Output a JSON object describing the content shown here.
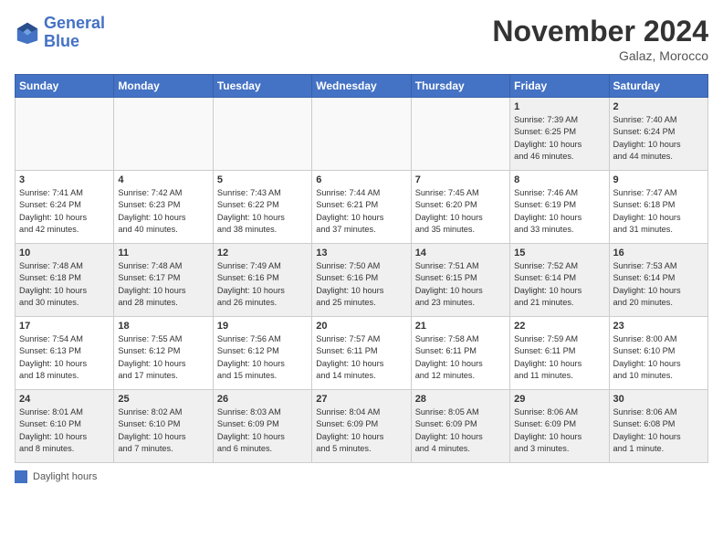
{
  "header": {
    "logo_general": "General",
    "logo_blue": "Blue",
    "month": "November 2024",
    "location": "Galaz, Morocco"
  },
  "days_of_week": [
    "Sunday",
    "Monday",
    "Tuesday",
    "Wednesday",
    "Thursday",
    "Friday",
    "Saturday"
  ],
  "legend": {
    "label": "Daylight hours"
  },
  "weeks": [
    [
      {
        "day": "",
        "info": ""
      },
      {
        "day": "",
        "info": ""
      },
      {
        "day": "",
        "info": ""
      },
      {
        "day": "",
        "info": ""
      },
      {
        "day": "",
        "info": ""
      },
      {
        "day": "1",
        "info": "Sunrise: 7:39 AM\nSunset: 6:25 PM\nDaylight: 10 hours\nand 46 minutes."
      },
      {
        "day": "2",
        "info": "Sunrise: 7:40 AM\nSunset: 6:24 PM\nDaylight: 10 hours\nand 44 minutes."
      }
    ],
    [
      {
        "day": "3",
        "info": "Sunrise: 7:41 AM\nSunset: 6:24 PM\nDaylight: 10 hours\nand 42 minutes."
      },
      {
        "day": "4",
        "info": "Sunrise: 7:42 AM\nSunset: 6:23 PM\nDaylight: 10 hours\nand 40 minutes."
      },
      {
        "day": "5",
        "info": "Sunrise: 7:43 AM\nSunset: 6:22 PM\nDaylight: 10 hours\nand 38 minutes."
      },
      {
        "day": "6",
        "info": "Sunrise: 7:44 AM\nSunset: 6:21 PM\nDaylight: 10 hours\nand 37 minutes."
      },
      {
        "day": "7",
        "info": "Sunrise: 7:45 AM\nSunset: 6:20 PM\nDaylight: 10 hours\nand 35 minutes."
      },
      {
        "day": "8",
        "info": "Sunrise: 7:46 AM\nSunset: 6:19 PM\nDaylight: 10 hours\nand 33 minutes."
      },
      {
        "day": "9",
        "info": "Sunrise: 7:47 AM\nSunset: 6:18 PM\nDaylight: 10 hours\nand 31 minutes."
      }
    ],
    [
      {
        "day": "10",
        "info": "Sunrise: 7:48 AM\nSunset: 6:18 PM\nDaylight: 10 hours\nand 30 minutes."
      },
      {
        "day": "11",
        "info": "Sunrise: 7:48 AM\nSunset: 6:17 PM\nDaylight: 10 hours\nand 28 minutes."
      },
      {
        "day": "12",
        "info": "Sunrise: 7:49 AM\nSunset: 6:16 PM\nDaylight: 10 hours\nand 26 minutes."
      },
      {
        "day": "13",
        "info": "Sunrise: 7:50 AM\nSunset: 6:16 PM\nDaylight: 10 hours\nand 25 minutes."
      },
      {
        "day": "14",
        "info": "Sunrise: 7:51 AM\nSunset: 6:15 PM\nDaylight: 10 hours\nand 23 minutes."
      },
      {
        "day": "15",
        "info": "Sunrise: 7:52 AM\nSunset: 6:14 PM\nDaylight: 10 hours\nand 21 minutes."
      },
      {
        "day": "16",
        "info": "Sunrise: 7:53 AM\nSunset: 6:14 PM\nDaylight: 10 hours\nand 20 minutes."
      }
    ],
    [
      {
        "day": "17",
        "info": "Sunrise: 7:54 AM\nSunset: 6:13 PM\nDaylight: 10 hours\nand 18 minutes."
      },
      {
        "day": "18",
        "info": "Sunrise: 7:55 AM\nSunset: 6:12 PM\nDaylight: 10 hours\nand 17 minutes."
      },
      {
        "day": "19",
        "info": "Sunrise: 7:56 AM\nSunset: 6:12 PM\nDaylight: 10 hours\nand 15 minutes."
      },
      {
        "day": "20",
        "info": "Sunrise: 7:57 AM\nSunset: 6:11 PM\nDaylight: 10 hours\nand 14 minutes."
      },
      {
        "day": "21",
        "info": "Sunrise: 7:58 AM\nSunset: 6:11 PM\nDaylight: 10 hours\nand 12 minutes."
      },
      {
        "day": "22",
        "info": "Sunrise: 7:59 AM\nSunset: 6:11 PM\nDaylight: 10 hours\nand 11 minutes."
      },
      {
        "day": "23",
        "info": "Sunrise: 8:00 AM\nSunset: 6:10 PM\nDaylight: 10 hours\nand 10 minutes."
      }
    ],
    [
      {
        "day": "24",
        "info": "Sunrise: 8:01 AM\nSunset: 6:10 PM\nDaylight: 10 hours\nand 8 minutes."
      },
      {
        "day": "25",
        "info": "Sunrise: 8:02 AM\nSunset: 6:10 PM\nDaylight: 10 hours\nand 7 minutes."
      },
      {
        "day": "26",
        "info": "Sunrise: 8:03 AM\nSunset: 6:09 PM\nDaylight: 10 hours\nand 6 minutes."
      },
      {
        "day": "27",
        "info": "Sunrise: 8:04 AM\nSunset: 6:09 PM\nDaylight: 10 hours\nand 5 minutes."
      },
      {
        "day": "28",
        "info": "Sunrise: 8:05 AM\nSunset: 6:09 PM\nDaylight: 10 hours\nand 4 minutes."
      },
      {
        "day": "29",
        "info": "Sunrise: 8:06 AM\nSunset: 6:09 PM\nDaylight: 10 hours\nand 3 minutes."
      },
      {
        "day": "30",
        "info": "Sunrise: 8:06 AM\nSunset: 6:08 PM\nDaylight: 10 hours\nand 1 minute."
      }
    ]
  ]
}
